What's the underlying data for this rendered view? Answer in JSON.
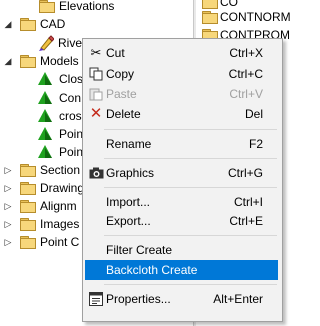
{
  "tree": {
    "items": [
      {
        "label": "Elevations",
        "icon": "folder-icon"
      },
      {
        "label": "CAD",
        "icon": "folder-icon",
        "expanded": true
      },
      {
        "label": "Rive",
        "icon": "pencil-icon"
      },
      {
        "label": "Models",
        "icon": "folder-icon",
        "expanded": true
      },
      {
        "label": "Clos",
        "icon": "pyramid-icon"
      },
      {
        "label": "Con",
        "icon": "pyramid-icon"
      },
      {
        "label": "cros",
        "icon": "pyramid-icon"
      },
      {
        "label": "Poin",
        "icon": "pyramid-icon"
      },
      {
        "label": "Poin",
        "icon": "pyramid-icon"
      },
      {
        "label": "Section",
        "icon": "folder-icon"
      },
      {
        "label": "Drawing",
        "icon": "folder-icon"
      },
      {
        "label": "Alignm",
        "icon": "folder-icon"
      },
      {
        "label": "Images",
        "icon": "folder-icon"
      },
      {
        "label": "Point C",
        "icon": "folder-icon"
      }
    ]
  },
  "right_pane": {
    "items": [
      {
        "label": "CO"
      },
      {
        "label": "CONTNORM"
      },
      {
        "label": "CONTPROM"
      }
    ]
  },
  "context_menu": {
    "items": [
      {
        "label": "Cut",
        "shortcut": "Ctrl+X",
        "icon": "scissors-icon"
      },
      {
        "label": "Copy",
        "shortcut": "Ctrl+C",
        "icon": "copy-icon"
      },
      {
        "label": "Paste",
        "shortcut": "Ctrl+V",
        "icon": "paste-icon",
        "disabled": true
      },
      {
        "label": "Delete",
        "shortcut": "Del",
        "icon": "delete-icon"
      },
      {
        "label": "Rename",
        "shortcut": "F2"
      },
      {
        "label": "Graphics",
        "shortcut": "Ctrl+G",
        "icon": "camera-icon"
      },
      {
        "label": "Import...",
        "shortcut": "Ctrl+I"
      },
      {
        "label": "Export...",
        "shortcut": "Ctrl+E"
      },
      {
        "label": "Filter Create",
        "shortcut": ""
      },
      {
        "label": "Backcloth Create",
        "shortcut": "",
        "selected": true
      },
      {
        "label": "Properties...",
        "shortcut": "Alt+Enter",
        "icon": "properties-icon"
      }
    ]
  },
  "colors": {
    "selection": "#0078d7",
    "menu_background": "#f2f2f2",
    "disabled_text": "#a0a0a0",
    "delete_icon": "#c42b1c",
    "pyramid": "#1fa21f"
  }
}
